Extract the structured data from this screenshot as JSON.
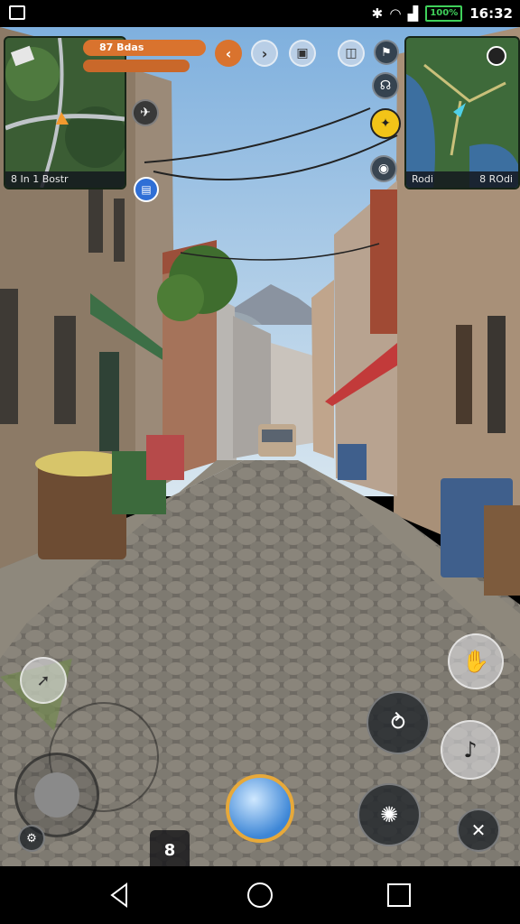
{
  "statusbar": {
    "time": "16:32",
    "battery": "100%"
  },
  "minimap_left": {
    "label_left": "8 In 1 Bostr",
    "label_right": ""
  },
  "minimap_right": {
    "label_left": "Rodi",
    "label_right": "8 ROdi"
  },
  "health_bar": {
    "label": "87 Bdas",
    "color": "#d9732e",
    "level": 0.85
  },
  "stamina_bar": {
    "label": "",
    "color": "#d9732e",
    "level": 0.7
  },
  "ammo": {
    "count": "8"
  },
  "xp": {
    "level": 0.55
  },
  "colors": {
    "hud_orange": "#d9732e",
    "hud_yellow": "#f2c418",
    "hud_blue": "#2f6fd6",
    "sky": "#a9cbe8"
  },
  "icons": {
    "top_row": [
      "chevron-left-icon",
      "chevron-right-icon",
      "backpack-icon",
      "chat-icon",
      "flag-icon"
    ],
    "right_column": [
      "headset-icon",
      "badge-icon",
      "compass-icon"
    ],
    "left_column": [
      "plane-icon",
      "document-icon"
    ],
    "action_buttons": [
      "grab-icon",
      "reload-icon",
      "alert-icon",
      "sprint-icon",
      "crouch-icon"
    ],
    "bottom_left": [
      "map-marker-icon",
      "settings-icon"
    ]
  }
}
